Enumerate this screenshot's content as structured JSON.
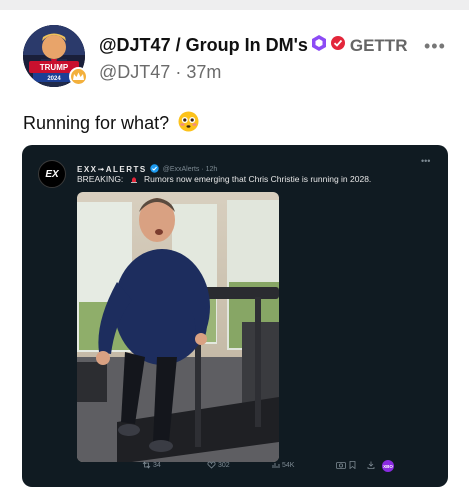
{
  "post": {
    "display_name": "@DJT47 / Group In DM's",
    "platform": "GETTR",
    "handle": "@DJT47",
    "separator": "·",
    "time": "37m",
    "text": "Running for what?"
  },
  "embed": {
    "logo_text": "EX",
    "account_name": "EXX➟ALERTS",
    "handle": "@ExxAlerts",
    "time": "12h",
    "breaking_label": "BREAKING:",
    "headline": "Rumors now emerging that Chris Christie is running in 2028.",
    "reply_count": "34",
    "like_count": "302",
    "view_count": "54K",
    "xbo_label": "XBO"
  },
  "icons": {
    "more": "more-horizontal-icon",
    "verified": "verified-badge-icon",
    "emoji": "flushed-face-emoji"
  },
  "colors": {
    "embed_background": "#101b22",
    "verified_purple": "#8c4bf5",
    "verified_red": "#e3263a",
    "twitter_blue": "#1d9bf0"
  }
}
